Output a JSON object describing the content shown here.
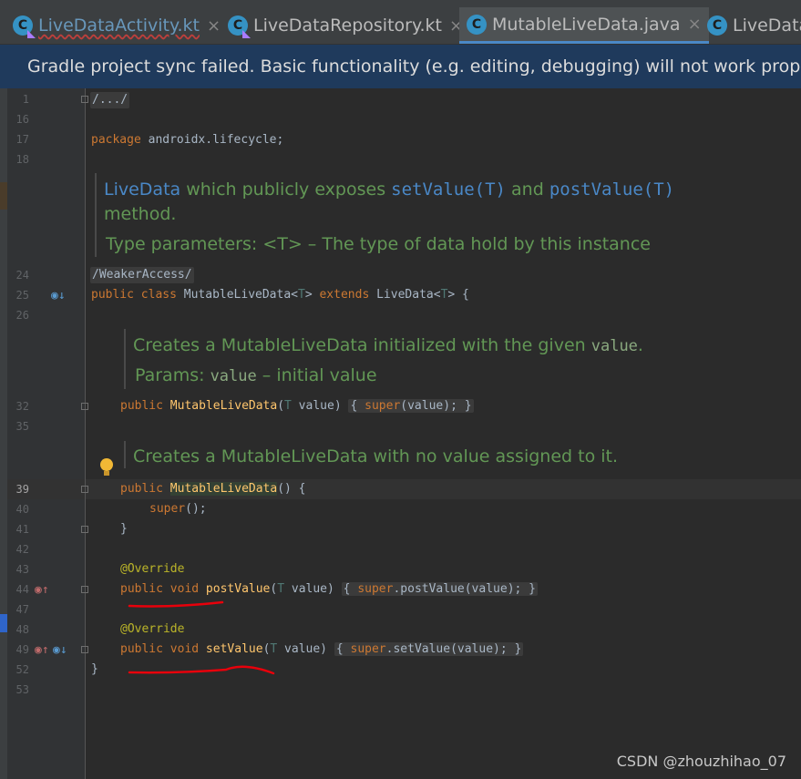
{
  "tabs": [
    {
      "label": "LiveDataActivity.kt",
      "icon": "C",
      "kind": "kotlin",
      "close": "×"
    },
    {
      "label": "LiveDataRepository.kt",
      "icon": "C",
      "kind": "kotlin",
      "close": "×"
    },
    {
      "label": "MutableLiveData.java",
      "icon": "C",
      "kind": "java",
      "close": "×"
    },
    {
      "label": "LiveData",
      "icon": "C",
      "kind": "java",
      "close": ""
    }
  ],
  "banner": "Gradle project sync failed. Basic functionality (e.g. editing, debugging) will not work properly",
  "lines": {
    "l1": "1",
    "l16": "16",
    "l17": "17",
    "l18": "18",
    "l24": "24",
    "l25": "25",
    "l26": "26",
    "l32": "32",
    "l35": "35",
    "l39": "39",
    "l40": "40",
    "l41": "41",
    "l42": "42",
    "l43": "43",
    "l44": "44",
    "l47": "47",
    "l48": "48",
    "l49": "49",
    "l52": "52",
    "l53": "53"
  },
  "code": {
    "fold_import": "/.../",
    "package_kw": "package",
    "package_name": " androidx.lifecycle;",
    "weaker_access": "/WeakerAccess/",
    "class_public": "public",
    "class_kw": " class",
    "class_name": " MutableLiveData<",
    "class_t": "T",
    "class_gt": ">",
    "extends_kw": " extends",
    "extends_name": " LiveData<",
    "extends_t": "T",
    "extends_end": "> {",
    "ctor1_public": "public",
    "ctor1_name": "MutableLiveData",
    "ctor1_open": "(",
    "ctor1_t": "T",
    "ctor1_param": " value)",
    "ctor1_body_open": "{ ",
    "ctor1_super": "super",
    "ctor1_body": "(value);",
    "ctor1_close": " }",
    "ctor2_public": "public",
    "ctor2_name": "MutableLiveData",
    "ctor2_rest": "() {",
    "ctor2_super": "super",
    "ctor2_super_rest": "();",
    "ctor2_close": "}",
    "override1": "@Override",
    "post_public": "public",
    "post_void": " void",
    "post_name": " postValue",
    "post_open": "(",
    "post_t": "T",
    "post_param": " value)",
    "post_body_open": "{ ",
    "post_super": "super",
    "post_body": ".postValue(value);",
    "post_close": " }",
    "override2": "@Override",
    "set_public": "public",
    "set_void": " void",
    "set_name": " setValue",
    "set_open": "(",
    "set_t": "T",
    "set_param": " value)",
    "set_body_open": "{ ",
    "set_super": "super",
    "set_body": ".setValue(value);",
    "set_close": " }",
    "class_close": "}"
  },
  "docs": {
    "d1_a": "LiveData",
    "d1_b": " which publicly exposes ",
    "d1_c": "setValue(T)",
    "d1_d": " and ",
    "d1_e": "postValue(T)",
    "d1_f": "method.",
    "d1_params": "Type parameters: <T> – The type of data hold by this instance",
    "d2_a": "Creates a MutableLiveData initialized with the given ",
    "d2_b": "value",
    "d2_c": ".",
    "d2_params_a": "Params: ",
    "d2_params_b": "value",
    "d2_params_c": " – initial value",
    "d3": "Creates a MutableLiveData with no value assigned to it."
  },
  "watermark": "CSDN @zhouzhihao_07",
  "colors": {
    "annotation_red": "#e8000b",
    "banner": "#1f3a5c",
    "doc": "#629755",
    "keyword": "#cc7832",
    "function": "#ffc66d"
  }
}
